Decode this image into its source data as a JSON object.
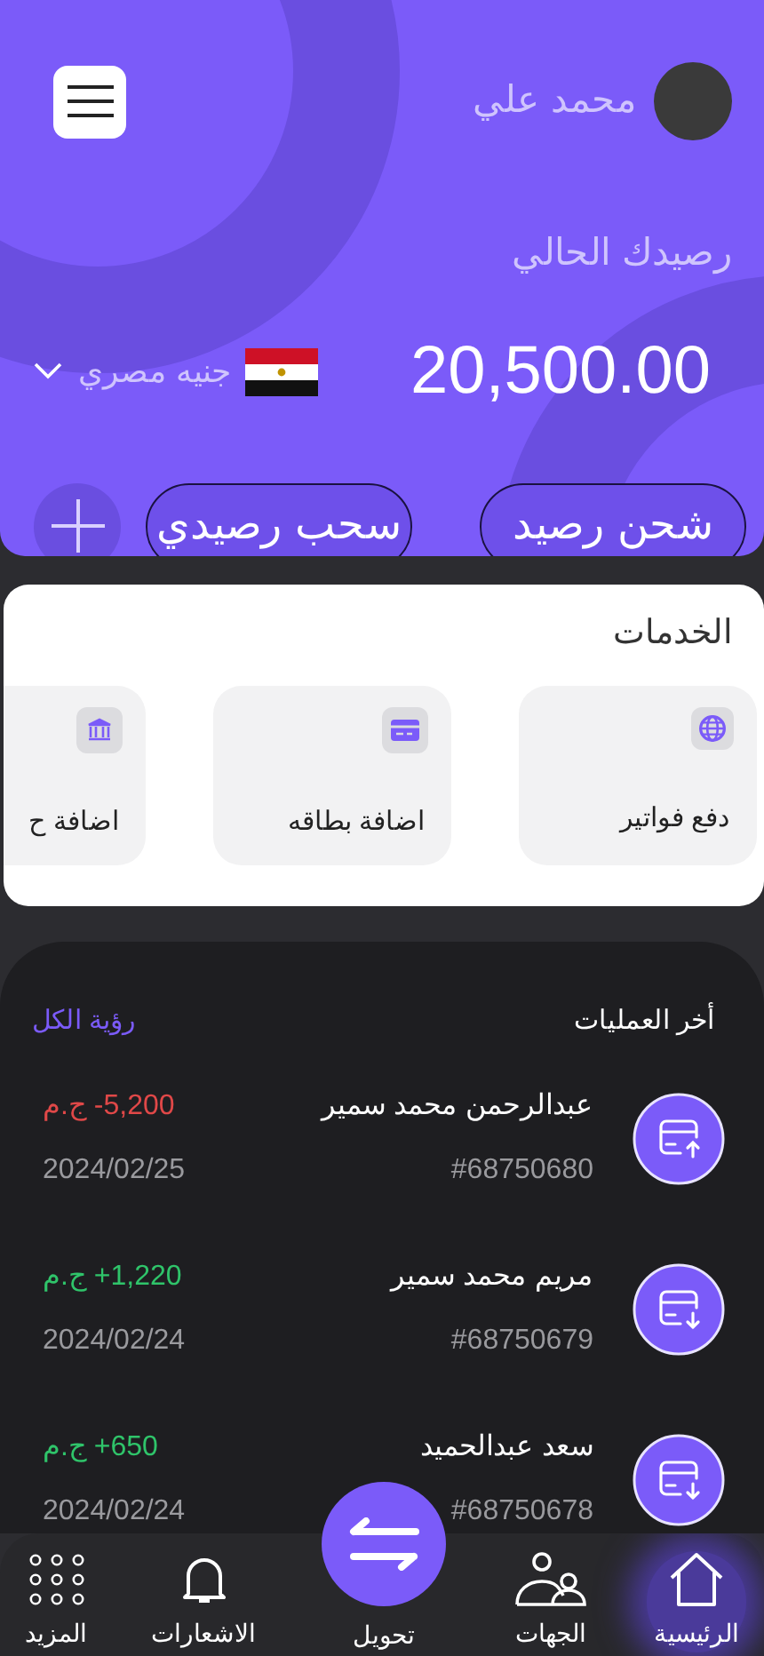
{
  "header": {
    "user_name": "محمد علي",
    "balance_label": "رصيدك الحالي",
    "balance": "20,500.00",
    "currency": "جنيه مصري",
    "actions": [
      {
        "kind": "button",
        "label": "شحن رصيد"
      },
      {
        "kind": "button",
        "label": "سحب رصيدي"
      },
      {
        "kind": "add"
      }
    ]
  },
  "services": {
    "title": "الخدمات",
    "items": [
      {
        "kind": "globe",
        "label": "دفع فواتير"
      },
      {
        "kind": "card",
        "label": "اضافة بطاقه"
      },
      {
        "kind": "bank",
        "label": "اضافة ح"
      }
    ]
  },
  "transactions": {
    "title": "أخر العمليات",
    "view_all": "رؤية الكل",
    "rows": [
      {
        "kind": "debit",
        "name": "عبدالرحمن محمد سمير",
        "ref": "#68750680",
        "amount": "-5,200",
        "currency": "ج.م",
        "date": "2024/02/25"
      },
      {
        "kind": "credit",
        "name": "مريم محمد سمير",
        "ref": "#68750679",
        "amount": "+1,220",
        "currency": "ج.م",
        "date": "2024/02/24"
      },
      {
        "kind": "credit",
        "name": "سعد عبدالحميد",
        "ref": "#68750678",
        "amount": "+650",
        "currency": "ج.م",
        "date": "2024/02/24"
      }
    ]
  },
  "nav": [
    {
      "kind": "home",
      "label": "الرئيسية",
      "selected": true
    },
    {
      "kind": "contacts",
      "label": "الجهات",
      "selected": false
    },
    {
      "kind": "transfer",
      "label": "تحويل",
      "selected": false
    },
    {
      "kind": "bell",
      "label": "الاشعارات",
      "selected": false
    },
    {
      "kind": "grid",
      "label": "المزيد",
      "selected": false
    }
  ]
}
